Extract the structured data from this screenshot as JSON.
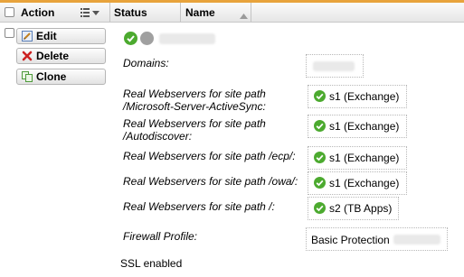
{
  "header": {
    "action_label": "Action",
    "status_label": "Status",
    "name_label": "Name"
  },
  "actions": {
    "edit_label": "Edit",
    "delete_label": "Delete",
    "clone_label": "Clone"
  },
  "fields": {
    "domains_label": "Domains:",
    "path_activesync_line1": "Real Webservers for site path",
    "path_activesync_line2": "/Microsoft-Server-ActiveSync:",
    "path_autodiscover_line1": "Real Webservers for site path",
    "path_autodiscover_line2": "/Autodiscover:",
    "path_ecp": "Real Webservers for site path /ecp/:",
    "path_owa": "Real Webservers for site path /owa/:",
    "path_root": "Real Webservers for site path /:",
    "firewall_label": "Firewall Profile:",
    "firewall_value": "Basic Protection",
    "ssl_label": "SSL enabled"
  },
  "servers": {
    "activesync": "s1 (Exchange)",
    "autodiscover": "s1 (Exchange)",
    "ecp": "s1 (Exchange)",
    "owa": "s1 (Exchange)",
    "root": "s2 (TB Apps)"
  },
  "colors": {
    "accent": "#e8a33c",
    "status_ok": "#4caa2f",
    "status_off": "#9c9c9c",
    "delete_red": "#cc2222"
  }
}
